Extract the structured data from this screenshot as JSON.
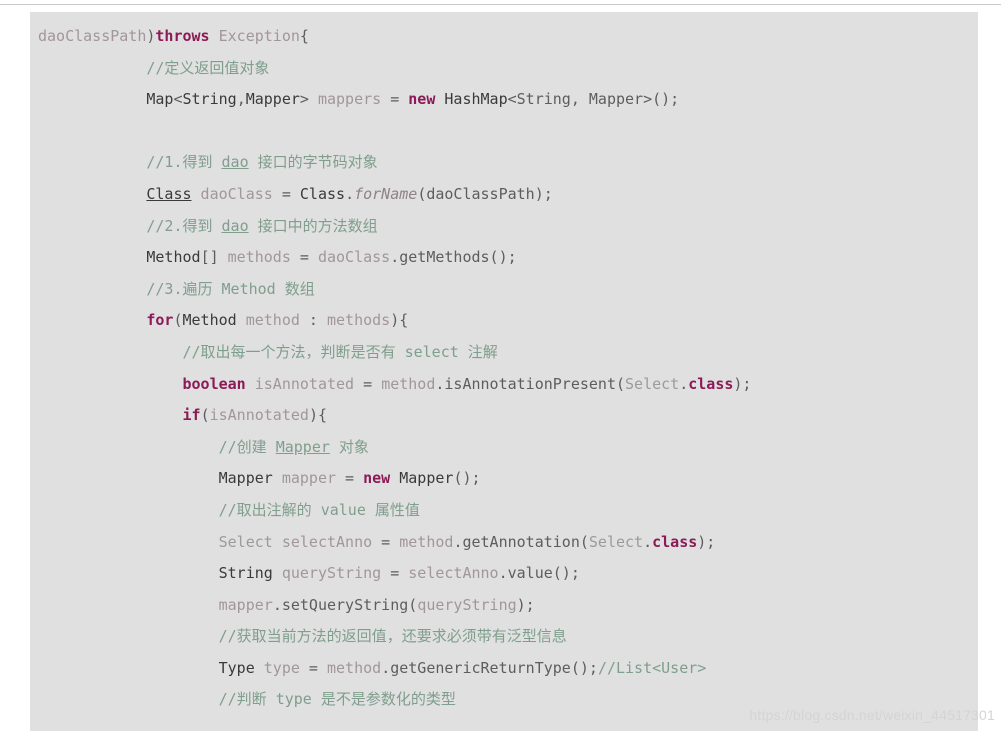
{
  "page": {
    "kind": "code-snippet",
    "background_color": "#ffffff",
    "code_background_color": "#e0e0e0",
    "language": "Java"
  },
  "colors": {
    "keyword": "#8b1a56",
    "comment": "#7f9e8d",
    "type": "#3a3a3a",
    "identifier": "#a2969b",
    "punctuation": "#5d5d5d",
    "dim_type": "#9b9b9b",
    "watermark": "#d4d4d4"
  },
  "watermark": {
    "text": "https://blog.csdn.net/weixin_44517301"
  },
  "code": {
    "lines": [
      "daoClassPath)throws Exception{",
      "            //定义返回值对象",
      "            Map<String,Mapper> mappers = new HashMap<String, Mapper>();",
      "",
      "            //1.得到 dao 接口的字节码对象",
      "            Class daoClass = Class.forName(daoClassPath);",
      "            //2.得到 dao 接口中的方法数组",
      "            Method[] methods = daoClass.getMethods();",
      "            //3.遍历 Method 数组",
      "            for(Method method : methods){",
      "                //取出每一个方法，判断是否有 select 注解",
      "                boolean isAnnotated = method.isAnnotationPresent(Select.class);",
      "                if(isAnnotated){",
      "                    //创建 Mapper 对象",
      "                    Mapper mapper = new Mapper();",
      "                    //取出注解的 value 属性值",
      "                    Select selectAnno = method.getAnnotation(Select.class);",
      "                    String queryString = selectAnno.value();",
      "                    mapper.setQueryString(queryString);",
      "                    //获取当前方法的返回值，还要求必须带有泛型信息",
      "                    Type type = method.getGenericReturnType();//List<User>",
      "                    //判断 type 是不是参数化的类型"
    ]
  },
  "tokens": {
    "line_1": [
      {
        "t": "daoClassPath",
        "c": "var"
      },
      {
        "t": ")",
        "c": "pun"
      },
      {
        "t": "throws",
        "c": "kw"
      },
      {
        "t": " ",
        "c": "pun"
      },
      {
        "t": "Exception",
        "c": "var"
      },
      {
        "t": "{",
        "c": "pun"
      }
    ],
    "line_2": [
      {
        "t": "//定义返回值对象",
        "c": "cm"
      }
    ],
    "line_3": [
      {
        "t": "Map",
        "c": "typ"
      },
      {
        "t": "<",
        "c": "pun"
      },
      {
        "t": "String",
        "c": "typ"
      },
      {
        "t": ",",
        "c": "pun"
      },
      {
        "t": "Mapper",
        "c": "typ"
      },
      {
        "t": "> ",
        "c": "pun"
      },
      {
        "t": "mappers",
        "c": "var"
      },
      {
        "t": " = ",
        "c": "pun"
      },
      {
        "t": "new",
        "c": "kw"
      },
      {
        "t": " HashMap",
        "c": "typ"
      },
      {
        "t": "<String, Mapper>();",
        "c": "pun"
      }
    ],
    "line_5": [
      {
        "t": "//1.得到 ",
        "c": "cm"
      },
      {
        "t": "dao",
        "c": "cmu"
      },
      {
        "t": " 接口的字节码对象",
        "c": "cm"
      }
    ],
    "line_6": [
      {
        "t": "Class",
        "c": "typu"
      },
      {
        "t": " daoClass",
        "c": "var"
      },
      {
        "t": " = ",
        "c": "pun"
      },
      {
        "t": "Class",
        "c": "typ"
      },
      {
        "t": ".",
        "c": "pun"
      },
      {
        "t": "forName",
        "c": "mth"
      },
      {
        "t": "(daoClassPath);",
        "c": "pun"
      }
    ],
    "line_7": [
      {
        "t": "//2.得到 ",
        "c": "cm"
      },
      {
        "t": "dao",
        "c": "cmu"
      },
      {
        "t": " 接口中的方法数组",
        "c": "cm"
      }
    ],
    "line_8": [
      {
        "t": "Method",
        "c": "typ"
      },
      {
        "t": "[] ",
        "c": "pun"
      },
      {
        "t": "methods",
        "c": "var"
      },
      {
        "t": " = ",
        "c": "pun"
      },
      {
        "t": "daoClass",
        "c": "var"
      },
      {
        "t": ".getMethods();",
        "c": "pun"
      }
    ],
    "line_9": [
      {
        "t": "//3.遍历 Method 数组",
        "c": "cm"
      }
    ],
    "line_10": [
      {
        "t": "for",
        "c": "kw"
      },
      {
        "t": "(",
        "c": "pun"
      },
      {
        "t": "Method",
        "c": "typ"
      },
      {
        "t": " method",
        "c": "var"
      },
      {
        "t": " : ",
        "c": "pun"
      },
      {
        "t": "methods",
        "c": "var"
      },
      {
        "t": "){",
        "c": "pun"
      }
    ],
    "line_11": [
      {
        "t": "//取出每一个方法，判断是否有 select 注解",
        "c": "cm"
      }
    ],
    "line_12": [
      {
        "t": "boolean",
        "c": "kw"
      },
      {
        "t": " isAnnotated",
        "c": "var"
      },
      {
        "t": " = ",
        "c": "pun"
      },
      {
        "t": "method",
        "c": "var"
      },
      {
        "t": ".isAnnotationPresent(",
        "c": "pun"
      },
      {
        "t": "Select",
        "c": "lit"
      },
      {
        "t": ".",
        "c": "pun"
      },
      {
        "t": "class",
        "c": "kw"
      },
      {
        "t": ");",
        "c": "pun"
      }
    ],
    "line_13": [
      {
        "t": "if",
        "c": "kw"
      },
      {
        "t": "(",
        "c": "pun"
      },
      {
        "t": "isAnnotated",
        "c": "var"
      },
      {
        "t": "){",
        "c": "pun"
      }
    ],
    "line_14": [
      {
        "t": "//创建 ",
        "c": "cm"
      },
      {
        "t": "Mapper",
        "c": "cmu"
      },
      {
        "t": " 对象",
        "c": "cm"
      }
    ],
    "line_15": [
      {
        "t": "Mapper",
        "c": "typ"
      },
      {
        "t": " mapper",
        "c": "var"
      },
      {
        "t": " = ",
        "c": "pun"
      },
      {
        "t": "new",
        "c": "kw"
      },
      {
        "t": " Mapper",
        "c": "typ"
      },
      {
        "t": "();",
        "c": "pun"
      }
    ],
    "line_16": [
      {
        "t": "//取出注解的 value 属性值",
        "c": "cm"
      }
    ],
    "line_17": [
      {
        "t": "Select",
        "c": "lit"
      },
      {
        "t": " selectAnno",
        "c": "var"
      },
      {
        "t": " = ",
        "c": "pun"
      },
      {
        "t": "method",
        "c": "var"
      },
      {
        "t": ".getAnnotation(",
        "c": "pun"
      },
      {
        "t": "Select",
        "c": "lit"
      },
      {
        "t": ".",
        "c": "pun"
      },
      {
        "t": "class",
        "c": "kw"
      },
      {
        "t": ");",
        "c": "pun"
      }
    ],
    "line_18": [
      {
        "t": "String",
        "c": "typ"
      },
      {
        "t": " queryString",
        "c": "var"
      },
      {
        "t": " = ",
        "c": "pun"
      },
      {
        "t": "selectAnno",
        "c": "var"
      },
      {
        "t": ".value();",
        "c": "pun"
      }
    ],
    "line_19": [
      {
        "t": "mapper",
        "c": "var"
      },
      {
        "t": ".setQueryString(",
        "c": "pun"
      },
      {
        "t": "queryString",
        "c": "var"
      },
      {
        "t": ");",
        "c": "pun"
      }
    ],
    "line_20": [
      {
        "t": "//获取当前方法的返回值，还要求必须带有泛型信息",
        "c": "cm"
      }
    ],
    "line_21": [
      {
        "t": "Type",
        "c": "typ"
      },
      {
        "t": " type",
        "c": "var"
      },
      {
        "t": " = ",
        "c": "pun"
      },
      {
        "t": "method",
        "c": "var"
      },
      {
        "t": ".getGenericReturnType();",
        "c": "pun"
      },
      {
        "t": "//List<User>",
        "c": "cm"
      }
    ],
    "line_22": [
      {
        "t": "//判断 type 是不是参数化的类型",
        "c": "cm"
      }
    ]
  }
}
